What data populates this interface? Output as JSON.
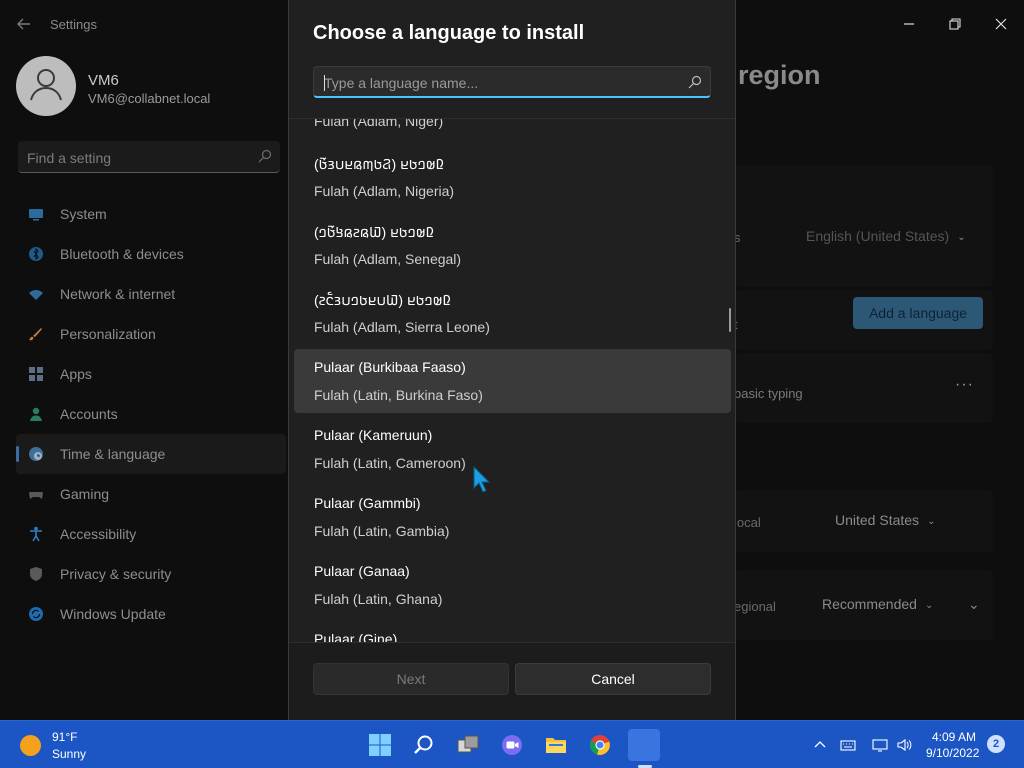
{
  "settings": {
    "app_title": "Settings",
    "profile": {
      "name": "VM6",
      "email": "VM6@collabnet.local"
    },
    "search_placeholder": "Find a setting",
    "nav": [
      {
        "label": "System",
        "icon": "monitor-icon"
      },
      {
        "label": "Bluetooth & devices",
        "icon": "bluetooth-icon"
      },
      {
        "label": "Network & internet",
        "icon": "wifi-icon"
      },
      {
        "label": "Personalization",
        "icon": "brush-icon"
      },
      {
        "label": "Apps",
        "icon": "apps-icon"
      },
      {
        "label": "Accounts",
        "icon": "person-icon"
      },
      {
        "label": "Time & language",
        "icon": "globe-clock-icon",
        "active": true
      },
      {
        "label": "Gaming",
        "icon": "gamepad-icon"
      },
      {
        "label": "Accessibility",
        "icon": "accessibility-icon"
      },
      {
        "label": "Privacy & security",
        "icon": "shield-icon"
      },
      {
        "label": "Windows Update",
        "icon": "update-icon"
      }
    ],
    "page_heading_partial": "region",
    "display_language_partial": "s",
    "display_language_value": "English (United States)",
    "preferred_partial": "t",
    "add_language_label": "Add a language",
    "basic_typing": "basic typing",
    "country_partial": "local",
    "country_value": "United States",
    "regional_partial": "egional",
    "regional_value": "Recommended"
  },
  "dialog": {
    "title": "Choose a language to install",
    "search_placeholder": "Type a language name...",
    "partial_top": "Fulah (Adlam, Niger)",
    "languages": [
      {
        "native": "(𞤐𞤢𞤶𞤫𞤪𞤭𞤴𞤢𞥄) 𞤆𞤵𞤤𞤢𞤪",
        "english": "Fulah (Adlam, Nigeria)"
      },
      {
        "native": "(𞤅𞤫𞤲𞤫𞤺𞤢𞥄𞤤) 𞤆𞤵𞤤𞤢𞤪",
        "english": "Fulah (Adlam, Senegal)"
      },
      {
        "native": "(𞤅𞤭𞤪𞤢𞤤𞤭𞤴𞤮𞥅𞤲) 𞤆𞤵𞤤𞤢𞤪",
        "english": "Fulah (Adlam, Sierra Leone)"
      },
      {
        "native": "Pulaar (Burkibaa Faaso)",
        "english": "Fulah (Latin, Burkina Faso)",
        "selected": true
      },
      {
        "native": "Pulaar (Kameruun)",
        "english": "Fulah (Latin, Cameroon)"
      },
      {
        "native": "Pulaar (Gammbi)",
        "english": "Fulah (Latin, Gambia)"
      },
      {
        "native": "Pulaar (Ganaa)",
        "english": "Fulah (Latin, Ghana)"
      },
      {
        "native": "Pulaar (Gine)",
        "english": ""
      }
    ],
    "next_label": "Next",
    "cancel_label": "Cancel"
  },
  "taskbar": {
    "weather": {
      "temp": "91°F",
      "condition": "Sunny"
    },
    "clock": {
      "time": "4:09 AM",
      "date": "9/10/2022"
    },
    "notification_count": "2"
  }
}
